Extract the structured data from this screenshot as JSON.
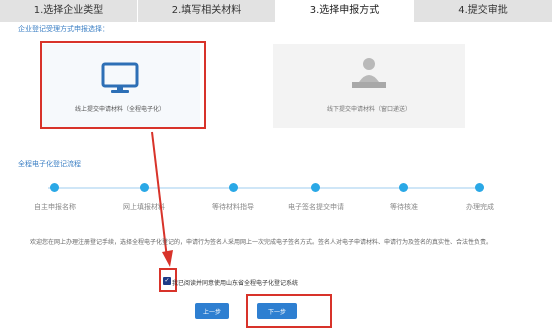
{
  "tabs": [
    {
      "label": "1.选择企业类型"
    },
    {
      "label": "2.填写相关材料"
    },
    {
      "label": "3.选择申报方式"
    },
    {
      "label": "4.提交审批"
    }
  ],
  "intro": "企业登记受理方式申报选择：",
  "cards": {
    "online_label": "线上提交申请材料（全程电子化）",
    "offline_label": "线下提交申请材料（窗口递送）"
  },
  "process": {
    "title": "全程电子化登记流程",
    "steps": [
      "自主申报名称",
      "网上填报材料",
      "等待材料指导",
      "电子签名提交申请",
      "等待核准",
      "办理完成"
    ]
  },
  "notice": "欢迎您在网上办理注册登记手续，选择全程电子化登记的，申请行为签名人采用网上一次完成电子签名方式。签名人对电子申请材料、申请行为及签名的真实性、合法性负责。",
  "agree_text": "我已阅读并同意使用山东省全程电子化登记系统",
  "buttons": {
    "prev": "上一步",
    "next": "下一步"
  },
  "colors": {
    "primary": "#2e7fd1",
    "highlight": "#d8332a"
  }
}
